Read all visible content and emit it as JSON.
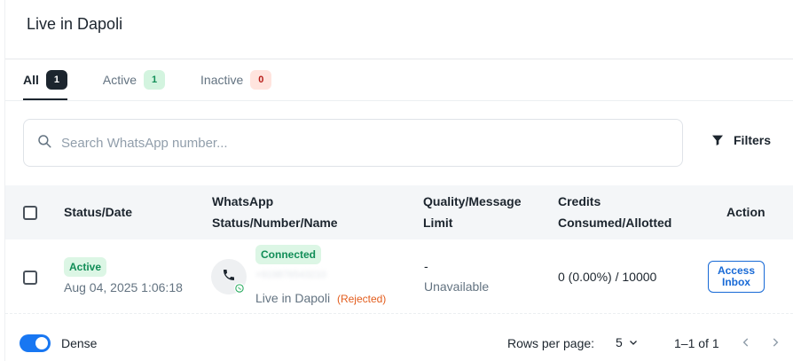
{
  "page": {
    "title": "Live in Dapoli"
  },
  "tabs": [
    {
      "label": "All",
      "count": "1"
    },
    {
      "label": "Active",
      "count": "1"
    },
    {
      "label": "Inactive",
      "count": "0"
    }
  ],
  "search": {
    "placeholder": "Search WhatsApp number..."
  },
  "filters": {
    "label": "Filters"
  },
  "table": {
    "headers": {
      "status_date": "Status/Date",
      "whatsapp_line1": "WhatsApp",
      "whatsapp_line2": "Status/Number/Name",
      "quality_line1": "Quality/Message",
      "quality_line2": "Limit",
      "credits_line1": "Credits",
      "credits_line2": "Consumed/Allotted",
      "action": "Action"
    },
    "rows": [
      {
        "status": "Active",
        "date": "Aug 04, 2025 1:06:18",
        "connection": "Connected",
        "number": "+919876543210",
        "name": "Live in Dapoli",
        "name_status": "(Rejected)",
        "quality": "-",
        "limit": "Unavailable",
        "credits": "0 (0.00%) / 10000",
        "action_line1": "Access",
        "action_line2": "Inbox"
      }
    ]
  },
  "footer": {
    "dense_label": "Dense",
    "rows_per_page_label": "Rows per page:",
    "rows_per_page_value": "5",
    "range": "1–1 of 1"
  },
  "colors": {
    "accent": "#1877f2",
    "success": "#118d57",
    "error": "#b71d18",
    "dark": "#1c252e"
  },
  "icons": [
    "search-icon",
    "filter-icon",
    "phone-icon",
    "whatsapp-icon",
    "chevron-down-icon",
    "chevron-left-icon",
    "chevron-right-icon"
  ]
}
